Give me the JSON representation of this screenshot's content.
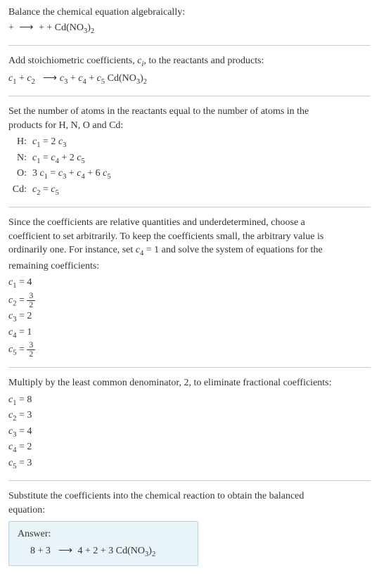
{
  "intro": {
    "line1": "Balance the chemical equation algebraically:",
    "line2_prefix": " + ",
    "line2_arrow": "⟶",
    "line2_suffix": " + + Cd(NO",
    "line2_sub1": "3",
    "line2_sub2": ")",
    "line2_sub3": "2"
  },
  "stoich": {
    "text": "Add stoichiometric coefficients, ",
    "ci": "c",
    "ci_sub": "i",
    "text2": ", to the reactants and products:",
    "eq_c1": "c",
    "eq_1": "1",
    "eq_plus1": " + ",
    "eq_c2": "c",
    "eq_2": "2",
    "eq_arrow": "⟶",
    "eq_c3": "c",
    "eq_3": "3",
    "eq_plus2": " + ",
    "eq_c4": "c",
    "eq_4": "4",
    "eq_plus3": " + ",
    "eq_c5": "c",
    "eq_5": "5",
    "eq_compound": " Cd(NO",
    "eq_compound_sub1": "3",
    "eq_compound_paren": ")",
    "eq_compound_sub2": "2"
  },
  "atoms": {
    "intro1": "Set the number of atoms in the reactants equal to the number of atoms in the",
    "intro2": "products for H, N, O and Cd:",
    "rows": [
      {
        "label": "H:",
        "lhs_c": "c",
        "lhs_n": "1",
        "eq": " = 2 ",
        "rhs_c": "c",
        "rhs_n": "3",
        "extra": ""
      },
      {
        "label": "N:",
        "lhs_c": "c",
        "lhs_n": "1",
        "eq": " = ",
        "rhs_c": "c",
        "rhs_n": "4",
        "extra": " + 2 ",
        "rhs2_c": "c",
        "rhs2_n": "5"
      },
      {
        "label": "O:",
        "lhs_pre": "3 ",
        "lhs_c": "c",
        "lhs_n": "1",
        "eq": " = ",
        "rhs_c": "c",
        "rhs_n": "3",
        "extra": " + ",
        "rhs2_c": "c",
        "rhs2_n": "4",
        "extra2": " + 6 ",
        "rhs3_c": "c",
        "rhs3_n": "5"
      },
      {
        "label": "Cd:",
        "lhs_c": "c",
        "lhs_n": "2",
        "eq": " = ",
        "rhs_c": "c",
        "rhs_n": "5",
        "extra": ""
      }
    ]
  },
  "choose": {
    "line1": "Since the coefficients are relative quantities and underdetermined, choose a",
    "line2": "coefficient to set arbitrarily. To keep the coefficients small, the arbitrary value is",
    "line3_a": "ordinarily one. For instance, set ",
    "line3_c": "c",
    "line3_n": "4",
    "line3_b": " = 1 and solve the system of equations for the",
    "line4": "remaining coefficients:"
  },
  "coefs1": {
    "c1": {
      "c": "c",
      "n": "1",
      "eq": " = 4"
    },
    "c2": {
      "c": "c",
      "n": "2",
      "eq": " = ",
      "num": "3",
      "den": "2"
    },
    "c3": {
      "c": "c",
      "n": "3",
      "eq": " = 2"
    },
    "c4": {
      "c": "c",
      "n": "4",
      "eq": " = 1"
    },
    "c5": {
      "c": "c",
      "n": "5",
      "eq": " = ",
      "num": "3",
      "den": "2"
    }
  },
  "multiply": {
    "text": "Multiply by the least common denominator, 2, to eliminate fractional coefficients:"
  },
  "coefs2": {
    "c1": {
      "c": "c",
      "n": "1",
      "eq": " = 8"
    },
    "c2": {
      "c": "c",
      "n": "2",
      "eq": " = 3"
    },
    "c3": {
      "c": "c",
      "n": "3",
      "eq": " = 4"
    },
    "c4": {
      "c": "c",
      "n": "4",
      "eq": " = 2"
    },
    "c5": {
      "c": "c",
      "n": "5",
      "eq": " = 3"
    }
  },
  "substitute": {
    "line1": "Substitute the coefficients into the chemical reaction to obtain the balanced",
    "line2": "equation:"
  },
  "answer": {
    "label": "Answer:",
    "eq_8": "8 ",
    "eq_p1": "+ 3 ",
    "eq_arrow": "⟶",
    "eq_4": " 4 ",
    "eq_p2": "+ 2 ",
    "eq_p3": "+ 3 Cd(NO",
    "eq_sub1": "3",
    "eq_paren": ")",
    "eq_sub2": "2"
  }
}
